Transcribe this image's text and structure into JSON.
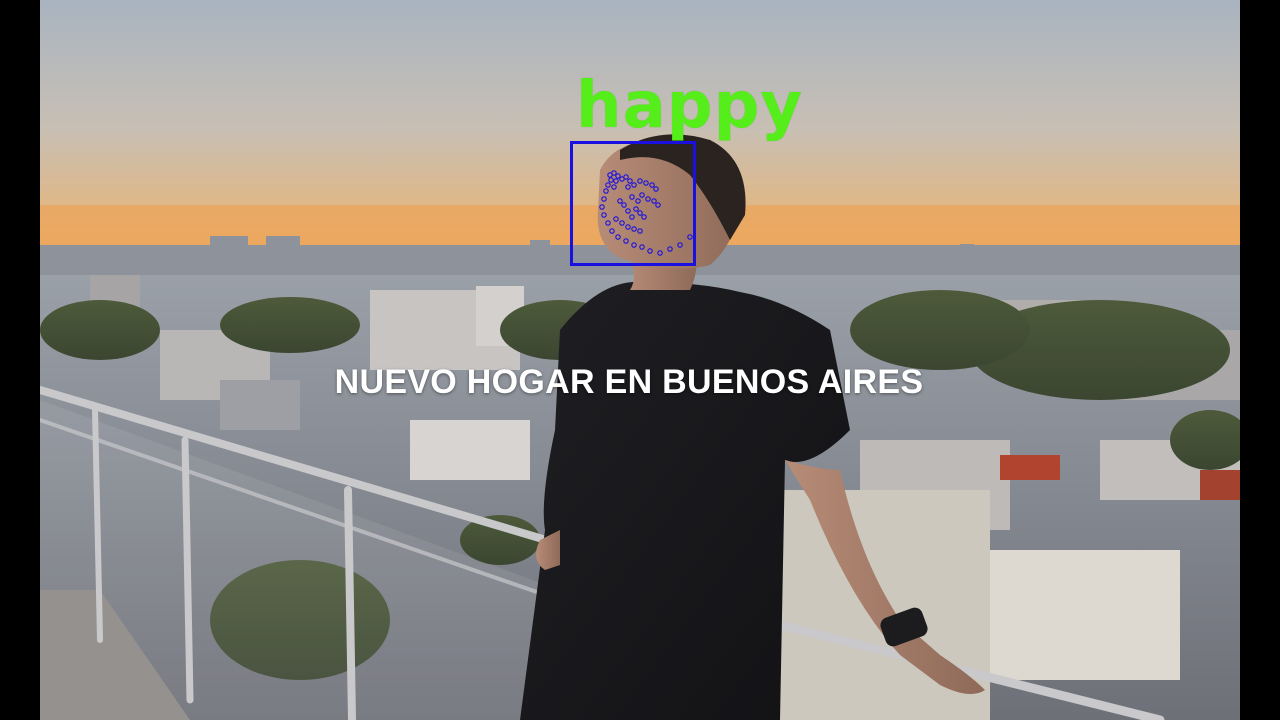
{
  "overlay": {
    "emotion_label": "happy",
    "emotion_color": "#55ee1a",
    "box_color": "#1a10e0"
  },
  "caption": {
    "text": "NUEVO HOGAR EN BUENOS AIRES",
    "color": "#ffffff"
  },
  "scene": {
    "description_icon": "sunset-city-rooftop"
  }
}
